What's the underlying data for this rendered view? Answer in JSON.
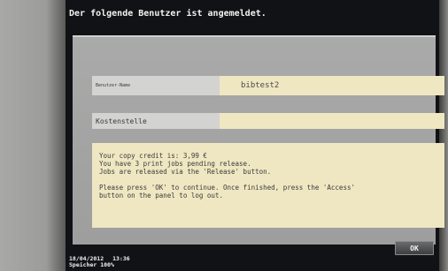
{
  "header": {
    "title": "Der folgende Benutzer ist angemeldet."
  },
  "fields": {
    "user_label": "Benutzer-Name",
    "user_value": "bibtest2",
    "cost_label": "Kostenstelle",
    "cost_value": ""
  },
  "message": {
    "lines": [
      "Your copy credit is: 3,99 €",
      "You have 3 print jobs pending release.",
      "Jobs are released via the 'Release' button.",
      "Please press 'OK' to continue. Once finished, press the 'Access'",
      "button on the panel to log out."
    ]
  },
  "footer": {
    "date": "18/04/2012",
    "time": "13:36",
    "memory_label": "Speicher",
    "memory_value": "100%"
  },
  "buttons": {
    "ok_label": "OK"
  },
  "colors": {
    "screen_bg": "#111215",
    "panel_bg": "#a9aaa9",
    "field_value_bg": "#efe7c2",
    "field_label_bg": "#d3d3d1"
  }
}
